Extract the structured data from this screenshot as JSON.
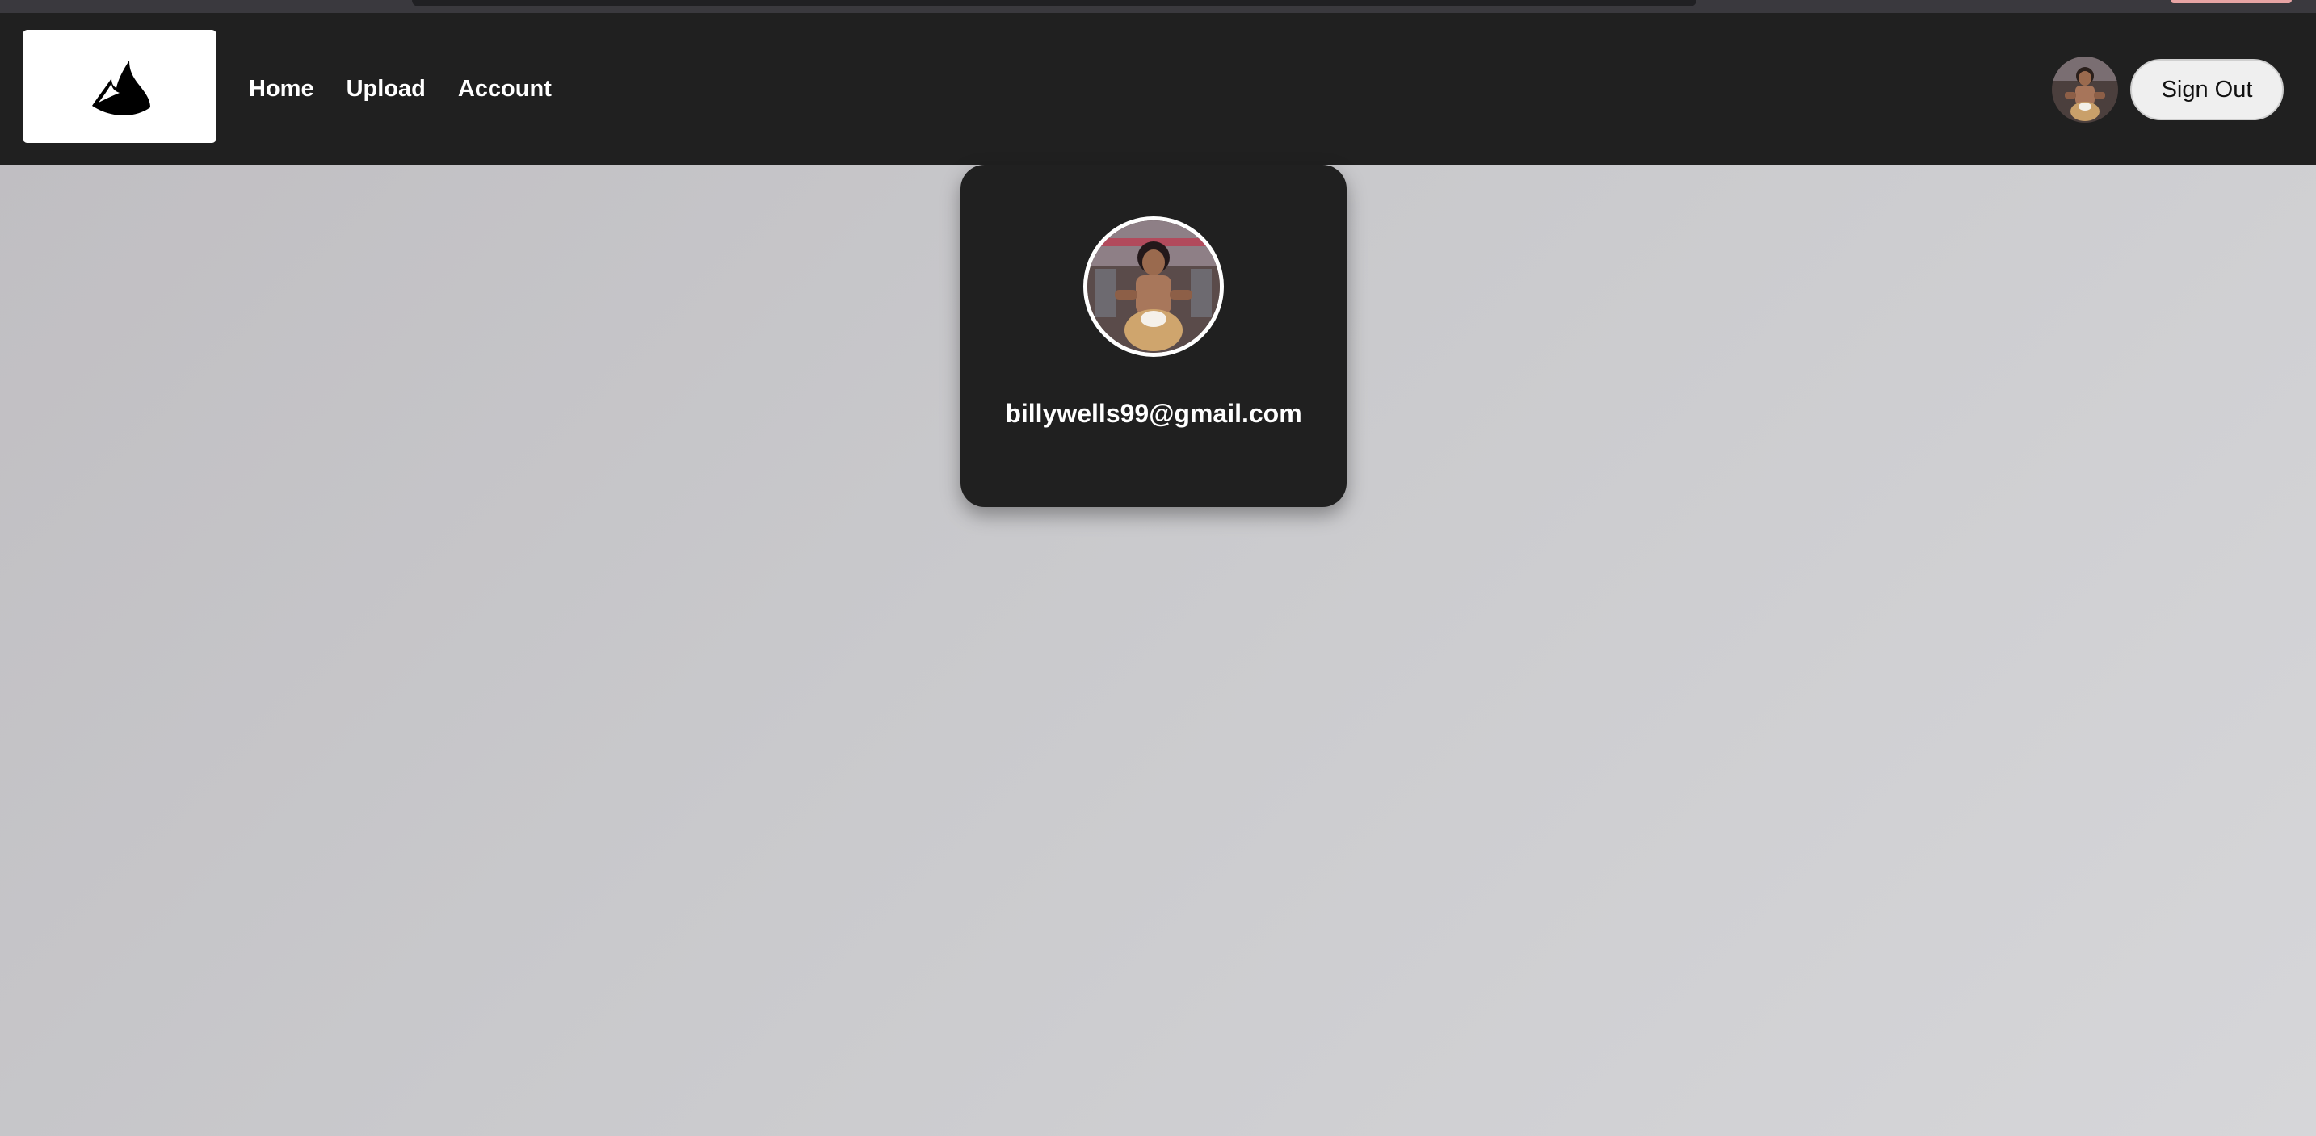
{
  "nav": {
    "logo_icon": "flame-mountain-logo",
    "links": [
      {
        "label": "Home"
      },
      {
        "label": "Upload"
      },
      {
        "label": "Account"
      }
    ],
    "avatar_icon": "user-avatar",
    "sign_out_label": "Sign Out"
  },
  "profile": {
    "avatar_icon": "user-avatar-large",
    "email": "billywells99@gmail.com"
  },
  "colors": {
    "navbar_bg": "#202020",
    "card_bg": "#202020",
    "page_bg_start": "#bfbdc1",
    "page_bg_end": "#d6d6d9",
    "text_light": "#ffffff",
    "button_bg": "#efefef"
  }
}
